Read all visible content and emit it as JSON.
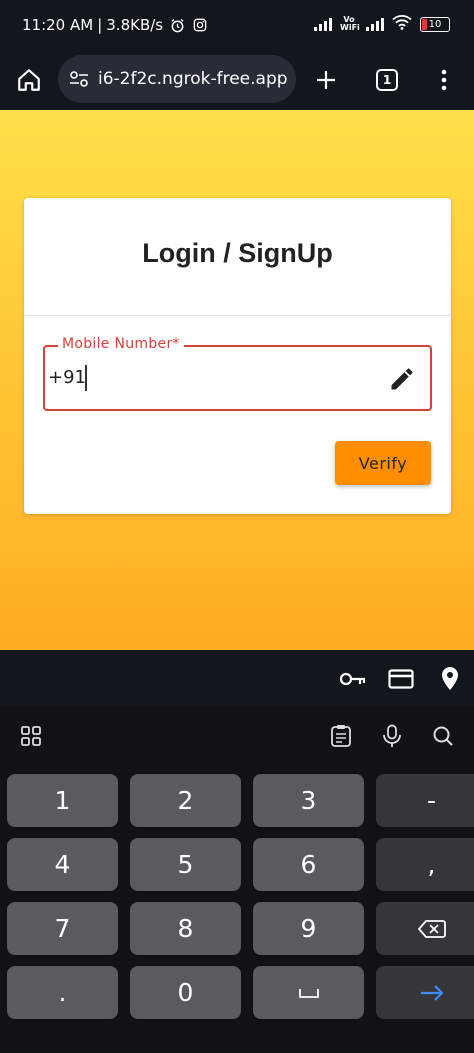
{
  "status_bar": {
    "time": "11:20 AM",
    "separator": "|",
    "network_speed": "3.8KB/s",
    "network_label": "Vo WiFi",
    "battery_level": "10",
    "icons": [
      "alarm-icon",
      "instagram-icon",
      "signal-icon",
      "vowifi-icon",
      "wifi-icon",
      "battery-icon"
    ]
  },
  "browser": {
    "url": "i6-2f2c.ngrok-free.app",
    "tab_count": "1",
    "icons": [
      "home-icon",
      "site-settings-icon",
      "new-tab-icon",
      "tab-switcher-icon",
      "menu-icon"
    ]
  },
  "login_card": {
    "title": "Login / SignUp",
    "mobile_field": {
      "label": "Mobile Number*",
      "prefix": "+91",
      "value": "",
      "border_color": "#d6423a"
    },
    "verify_label": "Verify",
    "verify_color": "#ff8f00"
  },
  "autofill_bar": {
    "icons": [
      "key-icon",
      "credit-card-icon",
      "location-pin-icon"
    ]
  },
  "keyboard": {
    "toolbar_icons": [
      "apps-grid-icon",
      "clipboard-icon",
      "microphone-icon",
      "search-icon"
    ],
    "rows": [
      [
        "1",
        "2",
        "3",
        "-"
      ],
      [
        "4",
        "5",
        "6",
        ","
      ],
      [
        "7",
        "8",
        "9",
        "backspace"
      ],
      [
        ".",
        "0",
        "space",
        "enter"
      ]
    ],
    "accent_color": "#3d8bff"
  },
  "colors": {
    "gradient_top": "#ffe04a",
    "gradient_bottom": "#ffad23",
    "system_bg": "#12161d"
  }
}
